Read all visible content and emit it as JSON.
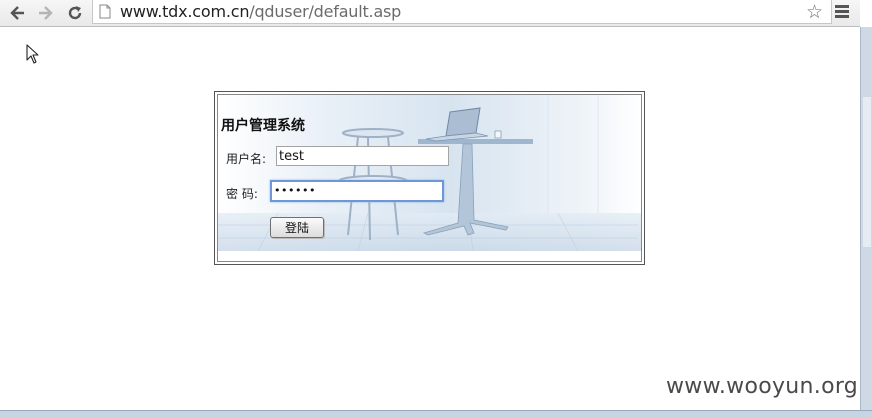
{
  "browser": {
    "url_host": "www.tdx.com.cn",
    "url_path": "/qduser/default.asp"
  },
  "login": {
    "title": "用户管理系统",
    "username_label": "用户名:",
    "username_value": "test",
    "password_label": "密 码:",
    "password_value": "••••••",
    "submit_label": "登陆"
  },
  "watermark": "www.wooyun.org"
}
